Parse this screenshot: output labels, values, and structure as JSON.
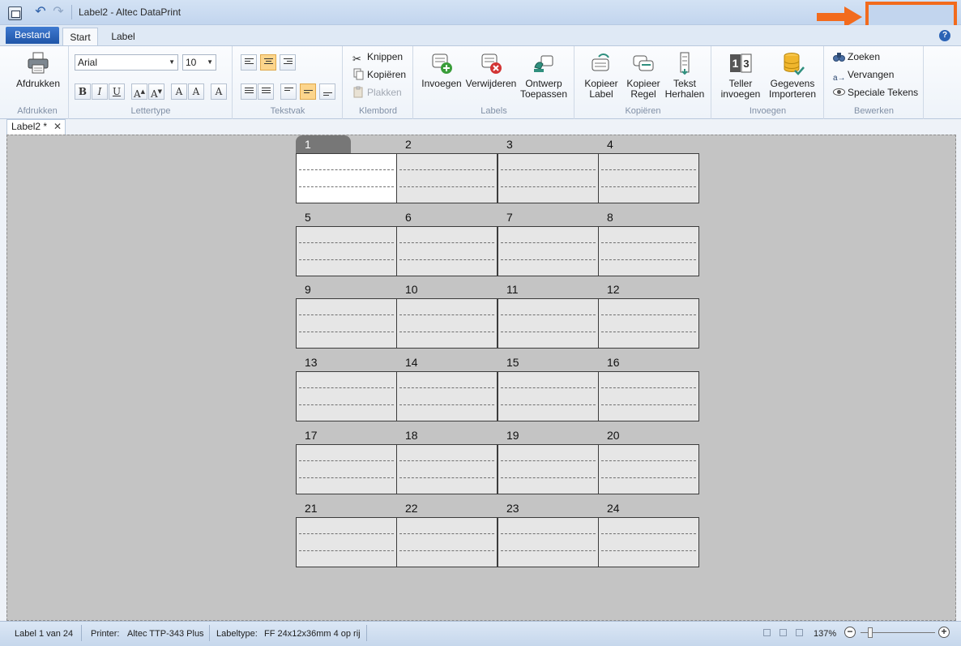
{
  "window": {
    "title": "Label2 - Altec DataPrint"
  },
  "ribbon_tabs": {
    "file": "Bestand",
    "tabs": [
      "Start",
      "Label"
    ]
  },
  "groups": {
    "afdrukken": {
      "label": "Afdrukken",
      "print_button": "Afdrukken"
    },
    "lettertype": {
      "label": "Lettertype",
      "font": "Arial",
      "size": "10"
    },
    "tekstvak": {
      "label": "Tekstvak"
    },
    "klembord": {
      "label": "Klembord",
      "cut": "Knippen",
      "copy": "Kopiëren",
      "paste": "Plakken"
    },
    "labels": {
      "label": "Labels",
      "insert": "Invoegen",
      "delete": "Verwijderen",
      "design_l1": "Ontwerp",
      "design_l2": "Toepassen"
    },
    "kopieren": {
      "label": "Kopiëren",
      "copy_label_l1": "Kopieer",
      "copy_label_l2": "Label",
      "copy_row_l1": "Kopieer",
      "copy_row_l2": "Regel",
      "repeat_l1": "Tekst",
      "repeat_l2": "Herhalen"
    },
    "invoegen": {
      "label": "Invoegen",
      "counter_l1": "Teller",
      "counter_l2": "invoegen",
      "import_l1": "Gegevens",
      "import_l2": "Importeren"
    },
    "bewerken": {
      "label": "Bewerken",
      "find": "Zoeken",
      "replace": "Vervangen",
      "special": "Speciale Tekens"
    }
  },
  "document_tab": {
    "name": "Label2 *"
  },
  "labels": {
    "numbers": [
      "1",
      "2",
      "3",
      "4",
      "5",
      "6",
      "7",
      "8",
      "9",
      "10",
      "11",
      "12",
      "13",
      "14",
      "15",
      "16",
      "17",
      "18",
      "19",
      "20",
      "21",
      "22",
      "23",
      "24"
    ],
    "selected": 1
  },
  "status": {
    "label_pos": "Label 1 van 24",
    "printer_label": "Printer:",
    "printer_value": "Altec TTP-343 Plus",
    "labeltype_label": "Labeltype:",
    "labeltype_value": "FF 24x12x36mm 4 op rij",
    "zoom": "137%",
    "zoom_level": 0.1
  },
  "colors": {
    "highlight": "#f26b1d",
    "file_tab": "#1f55a8",
    "canvas": "#c4c4c4"
  }
}
